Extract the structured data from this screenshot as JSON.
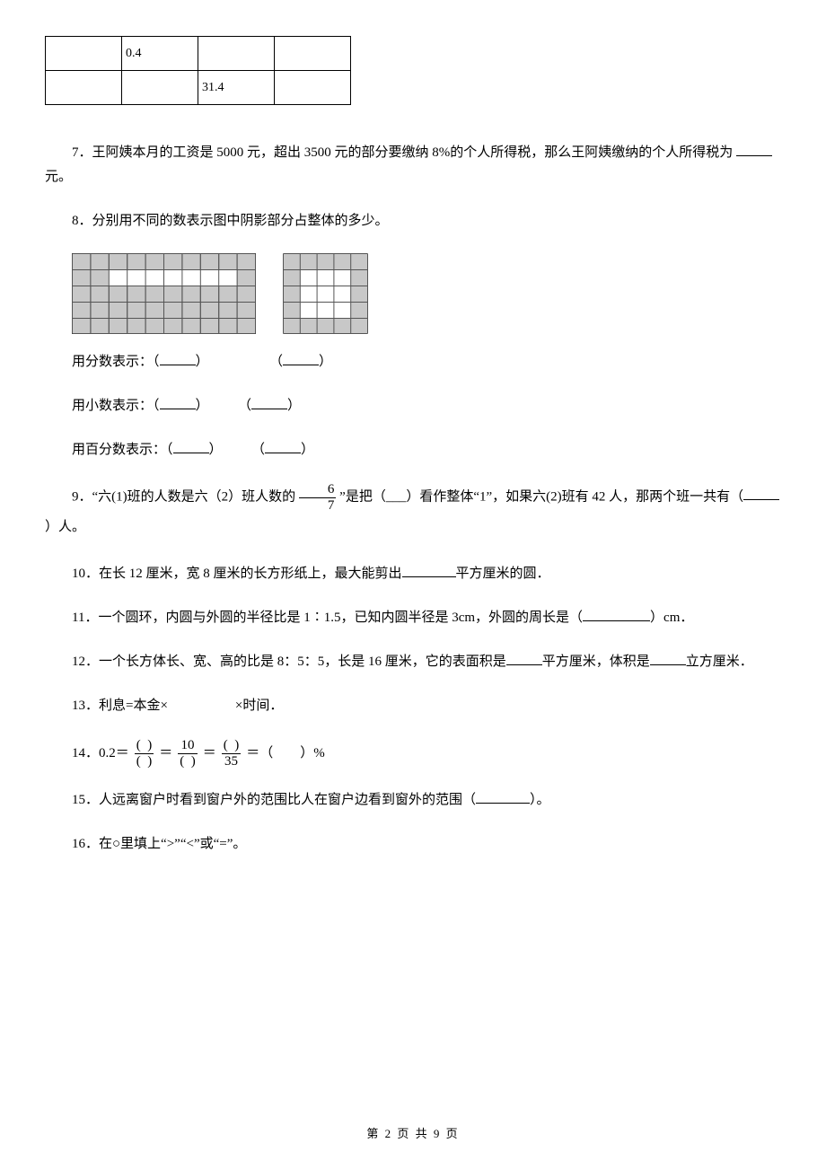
{
  "table": {
    "rows": [
      {
        "c1": "",
        "c2": "0.4",
        "c3": "",
        "c4": ""
      },
      {
        "c1": "",
        "c2": "",
        "c3": "31.4",
        "c4": ""
      }
    ]
  },
  "q7": {
    "text_a": "7．王阿姨本月的工资是 5000 元，超出 3500 元的部分要缴纳 8%的个人所得税，那么王阿姨缴纳的个人所得税为",
    "text_b": "元。"
  },
  "q8": {
    "intro": "8．分别用不同的数表示图中阴影部分占整体的多少。",
    "line_frac_label": "用分数表示：（",
    "line_dec_label": "用小数表示：（",
    "line_pct_label": "用百分数表示：（",
    "paren_sep": "）",
    "paren_open2": "（",
    "paren_close2": "）"
  },
  "q9": {
    "text_a": "9．“六(1)班的人数是六（2）班人数的",
    "frac_num": "6",
    "frac_den": "7",
    "text_b": "”是把（___）看作整体“1”，如果六(2)班有 42 人，那两个班一共有（",
    "text_c": "）人。"
  },
  "q10": {
    "text_a": "10．在长 12 厘米，宽 8 厘米的长方形纸上，最大能剪出",
    "text_b": "平方厘米的圆．"
  },
  "q11": {
    "text_a": "11．一个圆环，内圆与外圆的半径比是 1∶1.5，已知内圆半径是 3cm，外圆的周长是（",
    "text_b": "）cm．"
  },
  "q12": {
    "text_a": "12．一个长方体长、宽、高的比是 8：5：5，长是 16 厘米，它的表面积是",
    "text_b": "平方厘米，体积是",
    "text_c": "立方厘米．"
  },
  "q13": {
    "text": "13．利息=本金×　　　　　×时间．"
  },
  "q14": {
    "prefix": "14．0.2＝",
    "f1_num_open": "(",
    "f1_num_close": ")",
    "f1_den_open": "(",
    "f1_den_close": ")",
    "f2_num": "10",
    "f2_den_open": "(",
    "f2_den_close": ")",
    "f3_num_open": "(",
    "f3_num_close": ")",
    "f3_den": "35",
    "suffix": "＝（　　）%"
  },
  "q15": {
    "text_a": "15．人远离窗户时看到窗户外的范围比人在窗户边看到窗外的范围（",
    "text_b": "）。"
  },
  "q16": {
    "text": "16．在○里填上“>”“<”或“=”。"
  },
  "footer": {
    "text": "第 2 页 共 9 页"
  }
}
